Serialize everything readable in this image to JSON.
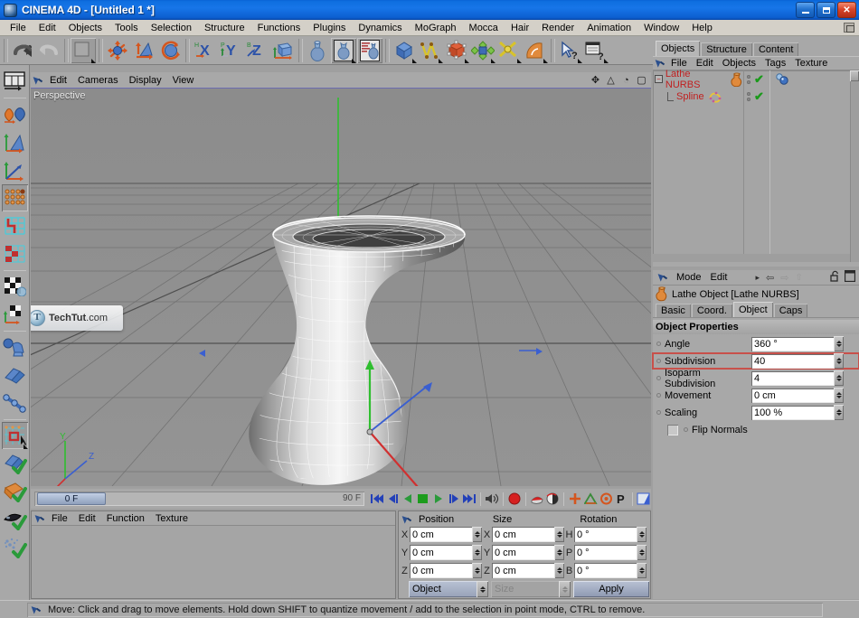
{
  "window": {
    "title": "CINEMA 4D - [Untitled 1 *]",
    "app_icon": "c4d-app-icon",
    "minimize": "_",
    "maximize": "□",
    "close": "✕"
  },
  "menubar": {
    "items": [
      "File",
      "Edit",
      "Objects",
      "Tools",
      "Selection",
      "Structure",
      "Functions",
      "Plugins",
      "Dynamics",
      "MoGraph",
      "Mocca",
      "Hair",
      "Render",
      "Animation",
      "Window",
      "Help"
    ]
  },
  "toolbar": {
    "items": [
      {
        "name": "undo-icon",
        "label": "Undo"
      },
      {
        "name": "redo-icon",
        "label": "Redo"
      },
      {
        "name": "live-selection-icon",
        "label": "Live Selection"
      },
      {
        "name": "move-tool-icon",
        "label": "Move"
      },
      {
        "name": "scale-tool-icon",
        "label": "Scale"
      },
      {
        "name": "rotate-tool-icon",
        "label": "Rotate"
      },
      {
        "name": "x-axis-lock-icon",
        "label": "X"
      },
      {
        "name": "y-axis-lock-icon",
        "label": "Y"
      },
      {
        "name": "z-axis-lock-icon",
        "label": "Z"
      },
      {
        "name": "world-object-coord-icon",
        "label": "World/Object"
      },
      {
        "name": "make-editable-icon",
        "label": "Make Editable"
      },
      {
        "name": "model-mode-icon",
        "label": "Model Mode"
      },
      {
        "name": "texture-mode-icon",
        "label": "Texture Mode"
      },
      {
        "name": "cube-primitive-icon",
        "label": "Cube"
      },
      {
        "name": "spline-icon",
        "label": "Spline"
      },
      {
        "name": "nurbs-icon",
        "label": "NURBS"
      },
      {
        "name": "array-icon",
        "label": "Modeling Objects"
      },
      {
        "name": "deformer-icon",
        "label": "Deformer"
      },
      {
        "name": "scene-object-icon",
        "label": "Scene"
      },
      {
        "name": "help-cursor-icon",
        "label": "Help Cursor"
      },
      {
        "name": "help-doc-icon",
        "label": "Help Document"
      }
    ]
  },
  "left_toolbar": {
    "items": [
      {
        "name": "layout-icon",
        "label": "Layout"
      },
      {
        "name": "object-axis-icon",
        "label": "Object / Axis Mode"
      },
      {
        "name": "model-mode-icon",
        "label": "Model Mode"
      },
      {
        "name": "axis-mode-icon",
        "label": "Axis Mode"
      },
      {
        "name": "point-mode-icon",
        "label": "Point Mode",
        "selected": true
      },
      {
        "name": "edge-mode-icon",
        "label": "Edge Mode"
      },
      {
        "name": "polygon-mode-icon",
        "label": "Polygon Mode"
      },
      {
        "name": "texture-axis-icon",
        "label": "Texture Axis"
      },
      {
        "name": "uv-polygon-icon",
        "label": "UV Polygon"
      },
      {
        "name": "animate-icon",
        "label": "Animation Mode"
      },
      {
        "name": "deformer-mode-icon",
        "label": "Deformer"
      },
      {
        "name": "joint-tool-icon",
        "label": "Joint Tool"
      },
      {
        "name": "viewport-solo-icon",
        "label": "Viewport Solo",
        "selected": true
      },
      {
        "name": "enable-axis-icon",
        "label": "Enable Axis Modification"
      },
      {
        "name": "texture-lock-icon",
        "label": "Texture Lock"
      },
      {
        "name": "quantize-icon",
        "label": "Quantize"
      },
      {
        "name": "snap-icon",
        "label": "Snap"
      }
    ]
  },
  "viewport": {
    "menu": [
      "Edit",
      "Cameras",
      "Display",
      "View"
    ],
    "label": "Perspective",
    "corner_icons": [
      {
        "name": "move-view-icon",
        "glyph": "✥"
      },
      {
        "name": "scale-view-icon",
        "glyph": "△"
      },
      {
        "name": "rotate-view-icon",
        "glyph": "◔"
      },
      {
        "name": "maximize-view-icon",
        "glyph": "▢"
      }
    ],
    "axis_labels": {
      "x": "X",
      "y": "Y",
      "z": "Z"
    },
    "watermark": {
      "brand": "TechTut",
      ".com": ".com"
    }
  },
  "timeline": {
    "current_frame": "0 F",
    "end_frame": "90 F",
    "buttons": [
      {
        "name": "go-to-start-button",
        "glyph": "|◀◀"
      },
      {
        "name": "step-back-button",
        "glyph": "◀|"
      },
      {
        "name": "play-reverse-button",
        "glyph": "◀"
      },
      {
        "name": "stop-button",
        "glyph": "■"
      },
      {
        "name": "play-button",
        "glyph": "▶"
      },
      {
        "name": "step-forward-button",
        "glyph": "|▶"
      },
      {
        "name": "go-to-end-button",
        "glyph": "▶▶|"
      },
      {
        "name": "sound-button",
        "glyph": "◀))"
      },
      {
        "name": "record-button",
        "glyph": "●"
      },
      {
        "name": "autokey-button",
        "glyph": "◐"
      },
      {
        "name": "keyframe-selection-button",
        "glyph": "◑"
      },
      {
        "name": "position-key-button",
        "glyph": "✛"
      },
      {
        "name": "scale-key-button",
        "glyph": "◬"
      },
      {
        "name": "rotation-key-button",
        "glyph": "◎"
      },
      {
        "name": "parameter-key-button",
        "glyph": "P"
      },
      {
        "name": "point-level-animation-button",
        "glyph": "▣"
      }
    ]
  },
  "material_manager": {
    "menu": [
      "File",
      "Edit",
      "Function",
      "Texture"
    ]
  },
  "coordinates": {
    "headers": [
      "Position",
      "Size",
      "Rotation"
    ],
    "rows": [
      {
        "pos_label": "X",
        "pos_value": "0 cm",
        "size_label": "X",
        "size_value": "0 cm",
        "rot_label": "H",
        "rot_value": "0 °"
      },
      {
        "pos_label": "Y",
        "pos_value": "0 cm",
        "size_label": "Y",
        "size_value": "0 cm",
        "rot_label": "P",
        "rot_value": "0 °"
      },
      {
        "pos_label": "Z",
        "pos_value": "0 cm",
        "size_label": "Z",
        "size_value": "0 cm",
        "rot_label": "B",
        "rot_value": "0 °"
      }
    ],
    "mode_select": "Object",
    "size_select": "Size",
    "apply_label": "Apply"
  },
  "object_manager": {
    "tabs": [
      {
        "label": "Objects",
        "active": true
      },
      {
        "label": "Structure",
        "active": false
      },
      {
        "label": "Content",
        "active": false
      }
    ],
    "menu": [
      "File",
      "Edit",
      "Objects",
      "Tags",
      "Texture"
    ],
    "rows": [
      {
        "name": "Lathe NURBS",
        "indent": 0,
        "icon": "lathe-nurbs-icon",
        "expander": "−",
        "visible_dot_top": "●",
        "visible_dot_bottom": "●",
        "check": "✔",
        "tag": "phong-tag-icon"
      },
      {
        "name": "Spline",
        "indent": 1,
        "icon": "spline-icon",
        "expander": "",
        "visible_dot_top": "●",
        "visible_dot_bottom": "●",
        "check": "✔",
        "tag": ""
      }
    ]
  },
  "attribute_manager": {
    "menu": [
      "Mode",
      "Edit"
    ],
    "nav_icons": [
      {
        "name": "history-arrow-icon",
        "glyph": "▸"
      },
      {
        "name": "back-arrow-icon",
        "glyph": "⇦"
      },
      {
        "name": "forward-arrow-icon",
        "glyph": "⇨"
      },
      {
        "name": "up-arrow-icon",
        "glyph": "⇧"
      },
      {
        "name": "lock-icon",
        "glyph": "🔓"
      },
      {
        "name": "panel-icon",
        "glyph": "▭"
      }
    ],
    "object_title": "Lathe Object [Lathe NURBS]",
    "object_icon": "lathe-nurbs-icon",
    "tabs": [
      {
        "label": "Basic",
        "active": false
      },
      {
        "label": "Coord.",
        "active": false
      },
      {
        "label": "Object",
        "active": true
      },
      {
        "label": "Caps",
        "active": false
      }
    ],
    "section_title": "Object Properties",
    "properties": [
      {
        "label": "Angle",
        "value": "360 °",
        "highlight": false,
        "type": "number"
      },
      {
        "label": "Subdivision",
        "value": "40",
        "highlight": true,
        "type": "number"
      },
      {
        "label": "Isoparm Subdivision",
        "value": "4",
        "highlight": false,
        "type": "number"
      },
      {
        "label": "Movement",
        "value": "0 cm",
        "highlight": false,
        "type": "number"
      },
      {
        "label": "Scaling",
        "value": "100 %",
        "highlight": false,
        "type": "number"
      },
      {
        "label": "Flip Normals",
        "value": "",
        "highlight": false,
        "type": "checkbox",
        "checked": false
      }
    ]
  },
  "status_bar": {
    "icon": "move-cursor-icon",
    "message": "Move: Click and drag to move elements. Hold down SHIFT to quantize movement / add to the selection in point mode, CTRL to remove."
  },
  "colors": {
    "titlebar_blue": "#0f6fe0",
    "panel_grey": "#a8a8a8",
    "viewport_grey": "#8e8e8e",
    "object_red": "#c02020",
    "highlight_red": "#c8504a",
    "axis_x": "#d03030",
    "axis_y": "#30b030",
    "axis_z": "#3050d0"
  }
}
